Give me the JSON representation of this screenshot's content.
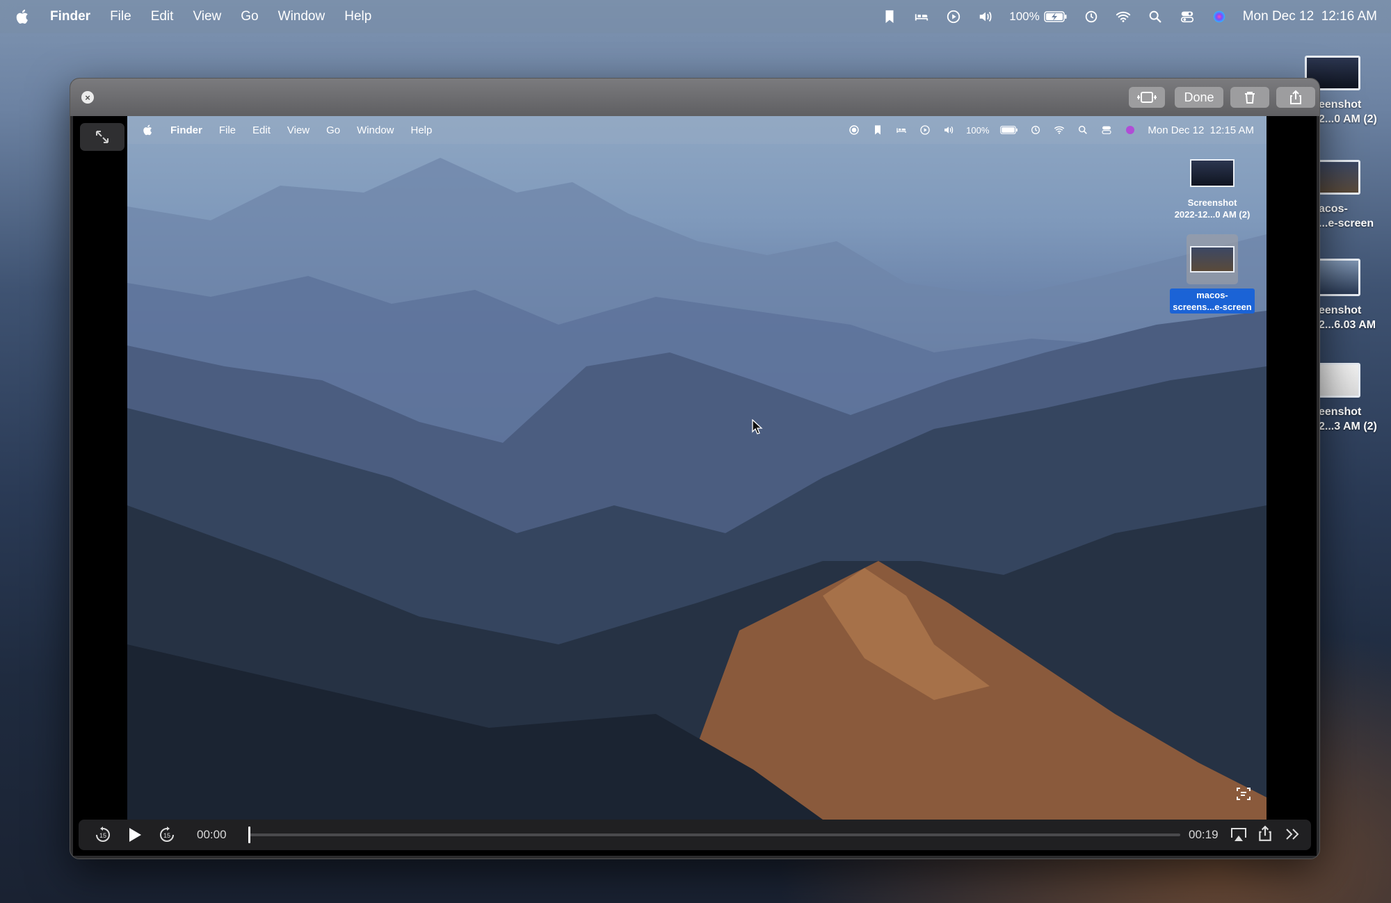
{
  "menubar": {
    "apple": "",
    "app": "Finder",
    "items": [
      "File",
      "Edit",
      "View",
      "Go",
      "Window",
      "Help"
    ],
    "battery": "100%",
    "clock": "Mon Dec 12  12:16 AM"
  },
  "desktop_icons": [
    {
      "label_l1": "eenshot",
      "label_l2": "2...0 AM (2)"
    },
    {
      "label_l1": "acos-",
      "label_l2": "...e-screen"
    },
    {
      "label_l1": "eenshot",
      "label_l2": "2...6.03 AM"
    },
    {
      "label_l1": "eenshot",
      "label_l2": "2...3 AM (2)"
    }
  ],
  "quicklook": {
    "done_label": "Done",
    "close_symbol": "×",
    "inner": {
      "app": "Finder",
      "items": [
        "File",
        "Edit",
        "View",
        "Go",
        "Window",
        "Help"
      ],
      "battery": "100%",
      "clock": "Mon Dec 12  12:15 AM",
      "icon1_l1": "Screenshot",
      "icon1_l2": "2022-12...0 AM (2)",
      "icon2_l1": "macos-",
      "icon2_l2": "screens...e-screen"
    },
    "player": {
      "time_current": "00:00",
      "time_total": "00:19",
      "progress": 0.0
    }
  }
}
